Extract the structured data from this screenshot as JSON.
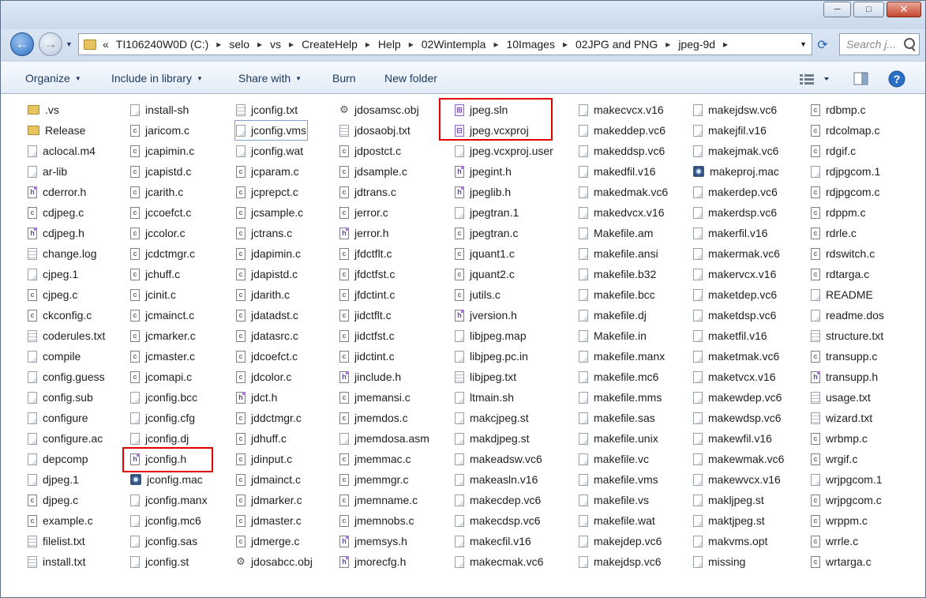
{
  "window": {
    "controls": {
      "minimize": "─",
      "maximize": "□",
      "close": "✕"
    }
  },
  "address": {
    "overflow": "«",
    "breadcrumbs": [
      "TI106240W0D (C:)",
      "selo",
      "vs",
      "CreateHelp",
      "Help",
      "02Wintempla",
      "10Images",
      "02JPG and PNG",
      "jpeg-9d"
    ],
    "separator": "▸"
  },
  "search": {
    "placeholder": "Search j..."
  },
  "toolbar": {
    "organize": "Organize",
    "include_in_library": "Include in library",
    "share_with": "Share with",
    "burn": "Burn",
    "new_folder": "New folder"
  },
  "icons": {
    "back": "back-arrow-icon",
    "forward": "forward-arrow-icon",
    "refresh": "refresh-icon",
    "search": "search-icon",
    "views": "view-options-icon",
    "preview": "preview-pane-icon",
    "help": "help-icon"
  },
  "highlight_color": "#e00000",
  "columns": [
    [
      {
        "name": ".vs",
        "icon": "folder"
      },
      {
        "name": "Release",
        "icon": "folder"
      },
      {
        "name": "aclocal.m4",
        "icon": "generic"
      },
      {
        "name": "ar-lib",
        "icon": "generic"
      },
      {
        "name": "cderror.h",
        "icon": "h"
      },
      {
        "name": "cdjpeg.c",
        "icon": "c"
      },
      {
        "name": "cdjpeg.h",
        "icon": "h"
      },
      {
        "name": "change.log",
        "icon": "text"
      },
      {
        "name": "cjpeg.1",
        "icon": "generic"
      },
      {
        "name": "cjpeg.c",
        "icon": "c"
      },
      {
        "name": "ckconfig.c",
        "icon": "c"
      },
      {
        "name": "coderules.txt",
        "icon": "text"
      },
      {
        "name": "compile",
        "icon": "generic"
      },
      {
        "name": "config.guess",
        "icon": "generic"
      },
      {
        "name": "config.sub",
        "icon": "generic"
      },
      {
        "name": "configure",
        "icon": "generic"
      },
      {
        "name": "configure.ac",
        "icon": "generic"
      },
      {
        "name": "depcomp",
        "icon": "generic"
      },
      {
        "name": "djpeg.1",
        "icon": "generic"
      },
      {
        "name": "djpeg.c",
        "icon": "c"
      },
      {
        "name": "example.c",
        "icon": "c"
      },
      {
        "name": "filelist.txt",
        "icon": "text"
      },
      {
        "name": "install.txt",
        "icon": "text"
      }
    ],
    [
      {
        "name": "install-sh",
        "icon": "generic"
      },
      {
        "name": "jaricom.c",
        "icon": "c"
      },
      {
        "name": "jcapimin.c",
        "icon": "c"
      },
      {
        "name": "jcapistd.c",
        "icon": "c"
      },
      {
        "name": "jcarith.c",
        "icon": "c"
      },
      {
        "name": "jccoefct.c",
        "icon": "c"
      },
      {
        "name": "jccolor.c",
        "icon": "c"
      },
      {
        "name": "jcdctmgr.c",
        "icon": "c"
      },
      {
        "name": "jchuff.c",
        "icon": "c"
      },
      {
        "name": "jcinit.c",
        "icon": "c"
      },
      {
        "name": "jcmainct.c",
        "icon": "c"
      },
      {
        "name": "jcmarker.c",
        "icon": "c"
      },
      {
        "name": "jcmaster.c",
        "icon": "c"
      },
      {
        "name": "jcomapi.c",
        "icon": "c"
      },
      {
        "name": "jconfig.bcc",
        "icon": "generic"
      },
      {
        "name": "jconfig.cfg",
        "icon": "generic"
      },
      {
        "name": "jconfig.dj",
        "icon": "generic"
      },
      {
        "name": "jconfig.h",
        "icon": "h"
      },
      {
        "name": "jconfig.mac",
        "icon": "mac"
      },
      {
        "name": "jconfig.manx",
        "icon": "generic"
      },
      {
        "name": "jconfig.mc6",
        "icon": "generic"
      },
      {
        "name": "jconfig.sas",
        "icon": "generic"
      },
      {
        "name": "jconfig.st",
        "icon": "generic"
      }
    ],
    [
      {
        "name": "jconfig.txt",
        "icon": "text"
      },
      {
        "name": "jconfig.vms",
        "icon": "generic"
      },
      {
        "name": "jconfig.wat",
        "icon": "generic"
      },
      {
        "name": "jcparam.c",
        "icon": "c"
      },
      {
        "name": "jcprepct.c",
        "icon": "c"
      },
      {
        "name": "jcsample.c",
        "icon": "c"
      },
      {
        "name": "jctrans.c",
        "icon": "c"
      },
      {
        "name": "jdapimin.c",
        "icon": "c"
      },
      {
        "name": "jdapistd.c",
        "icon": "c"
      },
      {
        "name": "jdarith.c",
        "icon": "c"
      },
      {
        "name": "jdatadst.c",
        "icon": "c"
      },
      {
        "name": "jdatasrc.c",
        "icon": "c"
      },
      {
        "name": "jdcoefct.c",
        "icon": "c"
      },
      {
        "name": "jdcolor.c",
        "icon": "c"
      },
      {
        "name": "jdct.h",
        "icon": "h"
      },
      {
        "name": "jddctmgr.c",
        "icon": "c"
      },
      {
        "name": "jdhuff.c",
        "icon": "c"
      },
      {
        "name": "jdinput.c",
        "icon": "c"
      },
      {
        "name": "jdmainct.c",
        "icon": "c"
      },
      {
        "name": "jdmarker.c",
        "icon": "c"
      },
      {
        "name": "jdmaster.c",
        "icon": "c"
      },
      {
        "name": "jdmerge.c",
        "icon": "c"
      },
      {
        "name": "jdosabcc.obj",
        "icon": "obj"
      }
    ],
    [
      {
        "name": "jdosamsc.obj",
        "icon": "obj"
      },
      {
        "name": "jdosaobj.txt",
        "icon": "text"
      },
      {
        "name": "jdpostct.c",
        "icon": "c"
      },
      {
        "name": "jdsample.c",
        "icon": "c"
      },
      {
        "name": "jdtrans.c",
        "icon": "c"
      },
      {
        "name": "jerror.c",
        "icon": "c"
      },
      {
        "name": "jerror.h",
        "icon": "h"
      },
      {
        "name": "jfdctflt.c",
        "icon": "c"
      },
      {
        "name": "jfdctfst.c",
        "icon": "c"
      },
      {
        "name": "jfdctint.c",
        "icon": "c"
      },
      {
        "name": "jidctflt.c",
        "icon": "c"
      },
      {
        "name": "jidctfst.c",
        "icon": "c"
      },
      {
        "name": "jidctint.c",
        "icon": "c"
      },
      {
        "name": "jinclude.h",
        "icon": "h"
      },
      {
        "name": "jmemansi.c",
        "icon": "c"
      },
      {
        "name": "jmemdos.c",
        "icon": "c"
      },
      {
        "name": "jmemdosa.asm",
        "icon": "generic"
      },
      {
        "name": "jmemmac.c",
        "icon": "c"
      },
      {
        "name": "jmemmgr.c",
        "icon": "c"
      },
      {
        "name": "jmemname.c",
        "icon": "c"
      },
      {
        "name": "jmemnobs.c",
        "icon": "c"
      },
      {
        "name": "jmemsys.h",
        "icon": "h"
      },
      {
        "name": "jmorecfg.h",
        "icon": "h"
      }
    ],
    [
      {
        "name": "jpeg.sln",
        "icon": "sln"
      },
      {
        "name": "jpeg.vcxproj",
        "icon": "proj"
      },
      {
        "name": "jpeg.vcxproj.user",
        "icon": "generic"
      },
      {
        "name": "jpegint.h",
        "icon": "h"
      },
      {
        "name": "jpeglib.h",
        "icon": "h"
      },
      {
        "name": "jpegtran.1",
        "icon": "generic"
      },
      {
        "name": "jpegtran.c",
        "icon": "c"
      },
      {
        "name": "jquant1.c",
        "icon": "c"
      },
      {
        "name": "jquant2.c",
        "icon": "c"
      },
      {
        "name": "jutils.c",
        "icon": "c"
      },
      {
        "name": "jversion.h",
        "icon": "h"
      },
      {
        "name": "libjpeg.map",
        "icon": "generic"
      },
      {
        "name": "libjpeg.pc.in",
        "icon": "generic"
      },
      {
        "name": "libjpeg.txt",
        "icon": "text"
      },
      {
        "name": "ltmain.sh",
        "icon": "generic"
      },
      {
        "name": "makcjpeg.st",
        "icon": "generic"
      },
      {
        "name": "makdjpeg.st",
        "icon": "generic"
      },
      {
        "name": "makeadsw.vc6",
        "icon": "generic"
      },
      {
        "name": "makeasln.v16",
        "icon": "generic"
      },
      {
        "name": "makecdep.vc6",
        "icon": "generic"
      },
      {
        "name": "makecdsp.vc6",
        "icon": "generic"
      },
      {
        "name": "makecfil.v16",
        "icon": "generic"
      },
      {
        "name": "makecmak.vc6",
        "icon": "generic"
      }
    ],
    [
      {
        "name": "makecvcx.v16",
        "icon": "generic"
      },
      {
        "name": "makeddep.vc6",
        "icon": "generic"
      },
      {
        "name": "makeddsp.vc6",
        "icon": "generic"
      },
      {
        "name": "makedfil.v16",
        "icon": "generic"
      },
      {
        "name": "makedmak.vc6",
        "icon": "generic"
      },
      {
        "name": "makedvcx.v16",
        "icon": "generic"
      },
      {
        "name": "Makefile.am",
        "icon": "generic"
      },
      {
        "name": "makefile.ansi",
        "icon": "generic"
      },
      {
        "name": "makefile.b32",
        "icon": "generic"
      },
      {
        "name": "makefile.bcc",
        "icon": "generic"
      },
      {
        "name": "makefile.dj",
        "icon": "generic"
      },
      {
        "name": "Makefile.in",
        "icon": "generic"
      },
      {
        "name": "makefile.manx",
        "icon": "generic"
      },
      {
        "name": "makefile.mc6",
        "icon": "generic"
      },
      {
        "name": "makefile.mms",
        "icon": "generic"
      },
      {
        "name": "makefile.sas",
        "icon": "generic"
      },
      {
        "name": "makefile.unix",
        "icon": "generic"
      },
      {
        "name": "makefile.vc",
        "icon": "generic"
      },
      {
        "name": "makefile.vms",
        "icon": "generic"
      },
      {
        "name": "makefile.vs",
        "icon": "generic"
      },
      {
        "name": "makefile.wat",
        "icon": "generic"
      },
      {
        "name": "makejdep.vc6",
        "icon": "generic"
      },
      {
        "name": "makejdsp.vc6",
        "icon": "generic"
      }
    ],
    [
      {
        "name": "makejdsw.vc6",
        "icon": "generic"
      },
      {
        "name": "makejfil.v16",
        "icon": "generic"
      },
      {
        "name": "makejmak.vc6",
        "icon": "generic"
      },
      {
        "name": "makeproj.mac",
        "icon": "mac"
      },
      {
        "name": "makerdep.vc6",
        "icon": "generic"
      },
      {
        "name": "makerdsp.vc6",
        "icon": "generic"
      },
      {
        "name": "makerfil.v16",
        "icon": "generic"
      },
      {
        "name": "makermak.vc6",
        "icon": "generic"
      },
      {
        "name": "makervcx.v16",
        "icon": "generic"
      },
      {
        "name": "maketdep.vc6",
        "icon": "generic"
      },
      {
        "name": "maketdsp.vc6",
        "icon": "generic"
      },
      {
        "name": "maketfil.v16",
        "icon": "generic"
      },
      {
        "name": "maketmak.vc6",
        "icon": "generic"
      },
      {
        "name": "maketvcx.v16",
        "icon": "generic"
      },
      {
        "name": "makewdep.vc6",
        "icon": "generic"
      },
      {
        "name": "makewdsp.vc6",
        "icon": "generic"
      },
      {
        "name": "makewfil.v16",
        "icon": "generic"
      },
      {
        "name": "makewmak.vc6",
        "icon": "generic"
      },
      {
        "name": "makewvcx.v16",
        "icon": "generic"
      },
      {
        "name": "makljpeg.st",
        "icon": "generic"
      },
      {
        "name": "maktjpeg.st",
        "icon": "generic"
      },
      {
        "name": "makvms.opt",
        "icon": "generic"
      },
      {
        "name": "missing",
        "icon": "generic"
      }
    ],
    [
      {
        "name": "rdbmp.c",
        "icon": "c"
      },
      {
        "name": "rdcolmap.c",
        "icon": "c"
      },
      {
        "name": "rdgif.c",
        "icon": "c"
      },
      {
        "name": "rdjpgcom.1",
        "icon": "generic"
      },
      {
        "name": "rdjpgcom.c",
        "icon": "c"
      },
      {
        "name": "rdppm.c",
        "icon": "c"
      },
      {
        "name": "rdrle.c",
        "icon": "c"
      },
      {
        "name": "rdswitch.c",
        "icon": "c"
      },
      {
        "name": "rdtarga.c",
        "icon": "c"
      },
      {
        "name": "README",
        "icon": "generic"
      },
      {
        "name": "readme.dos",
        "icon": "generic"
      },
      {
        "name": "structure.txt",
        "icon": "text"
      },
      {
        "name": "transupp.c",
        "icon": "c"
      },
      {
        "name": "transupp.h",
        "icon": "h"
      },
      {
        "name": "usage.txt",
        "icon": "text"
      },
      {
        "name": "wizard.txt",
        "icon": "text"
      },
      {
        "name": "wrbmp.c",
        "icon": "c"
      },
      {
        "name": "wrgif.c",
        "icon": "c"
      },
      {
        "name": "wrjpgcom.1",
        "icon": "generic"
      },
      {
        "name": "wrjpgcom.c",
        "icon": "c"
      },
      {
        "name": "wrppm.c",
        "icon": "c"
      },
      {
        "name": "wrrle.c",
        "icon": "c"
      },
      {
        "name": "wrtarga.c",
        "icon": "c"
      }
    ]
  ]
}
